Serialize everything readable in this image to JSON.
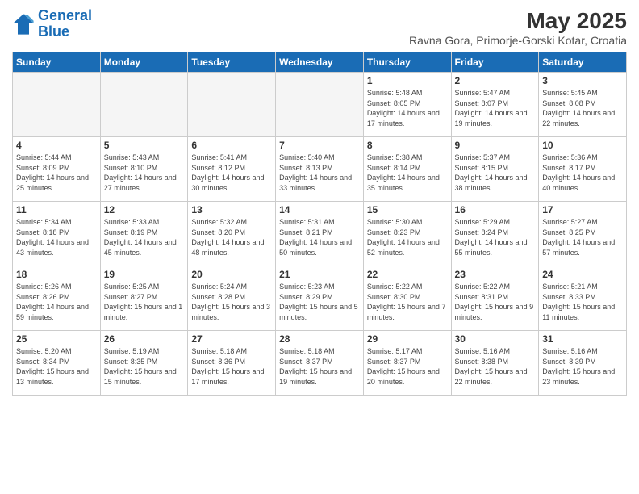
{
  "logo": {
    "line1": "General",
    "line2": "Blue"
  },
  "title": "May 2025",
  "subtitle": "Ravna Gora, Primorje-Gorski Kotar, Croatia",
  "days_of_week": [
    "Sunday",
    "Monday",
    "Tuesday",
    "Wednesday",
    "Thursday",
    "Friday",
    "Saturday"
  ],
  "weeks": [
    [
      {
        "day": "",
        "info": ""
      },
      {
        "day": "",
        "info": ""
      },
      {
        "day": "",
        "info": ""
      },
      {
        "day": "",
        "info": ""
      },
      {
        "day": "1",
        "info": "Sunrise: 5:48 AM\nSunset: 8:05 PM\nDaylight: 14 hours\nand 17 minutes."
      },
      {
        "day": "2",
        "info": "Sunrise: 5:47 AM\nSunset: 8:07 PM\nDaylight: 14 hours\nand 19 minutes."
      },
      {
        "day": "3",
        "info": "Sunrise: 5:45 AM\nSunset: 8:08 PM\nDaylight: 14 hours\nand 22 minutes."
      }
    ],
    [
      {
        "day": "4",
        "info": "Sunrise: 5:44 AM\nSunset: 8:09 PM\nDaylight: 14 hours\nand 25 minutes."
      },
      {
        "day": "5",
        "info": "Sunrise: 5:43 AM\nSunset: 8:10 PM\nDaylight: 14 hours\nand 27 minutes."
      },
      {
        "day": "6",
        "info": "Sunrise: 5:41 AM\nSunset: 8:12 PM\nDaylight: 14 hours\nand 30 minutes."
      },
      {
        "day": "7",
        "info": "Sunrise: 5:40 AM\nSunset: 8:13 PM\nDaylight: 14 hours\nand 33 minutes."
      },
      {
        "day": "8",
        "info": "Sunrise: 5:38 AM\nSunset: 8:14 PM\nDaylight: 14 hours\nand 35 minutes."
      },
      {
        "day": "9",
        "info": "Sunrise: 5:37 AM\nSunset: 8:15 PM\nDaylight: 14 hours\nand 38 minutes."
      },
      {
        "day": "10",
        "info": "Sunrise: 5:36 AM\nSunset: 8:17 PM\nDaylight: 14 hours\nand 40 minutes."
      }
    ],
    [
      {
        "day": "11",
        "info": "Sunrise: 5:34 AM\nSunset: 8:18 PM\nDaylight: 14 hours\nand 43 minutes."
      },
      {
        "day": "12",
        "info": "Sunrise: 5:33 AM\nSunset: 8:19 PM\nDaylight: 14 hours\nand 45 minutes."
      },
      {
        "day": "13",
        "info": "Sunrise: 5:32 AM\nSunset: 8:20 PM\nDaylight: 14 hours\nand 48 minutes."
      },
      {
        "day": "14",
        "info": "Sunrise: 5:31 AM\nSunset: 8:21 PM\nDaylight: 14 hours\nand 50 minutes."
      },
      {
        "day": "15",
        "info": "Sunrise: 5:30 AM\nSunset: 8:23 PM\nDaylight: 14 hours\nand 52 minutes."
      },
      {
        "day": "16",
        "info": "Sunrise: 5:29 AM\nSunset: 8:24 PM\nDaylight: 14 hours\nand 55 minutes."
      },
      {
        "day": "17",
        "info": "Sunrise: 5:27 AM\nSunset: 8:25 PM\nDaylight: 14 hours\nand 57 minutes."
      }
    ],
    [
      {
        "day": "18",
        "info": "Sunrise: 5:26 AM\nSunset: 8:26 PM\nDaylight: 14 hours\nand 59 minutes."
      },
      {
        "day": "19",
        "info": "Sunrise: 5:25 AM\nSunset: 8:27 PM\nDaylight: 15 hours\nand 1 minute."
      },
      {
        "day": "20",
        "info": "Sunrise: 5:24 AM\nSunset: 8:28 PM\nDaylight: 15 hours\nand 3 minutes."
      },
      {
        "day": "21",
        "info": "Sunrise: 5:23 AM\nSunset: 8:29 PM\nDaylight: 15 hours\nand 5 minutes."
      },
      {
        "day": "22",
        "info": "Sunrise: 5:22 AM\nSunset: 8:30 PM\nDaylight: 15 hours\nand 7 minutes."
      },
      {
        "day": "23",
        "info": "Sunrise: 5:22 AM\nSunset: 8:31 PM\nDaylight: 15 hours\nand 9 minutes."
      },
      {
        "day": "24",
        "info": "Sunrise: 5:21 AM\nSunset: 8:33 PM\nDaylight: 15 hours\nand 11 minutes."
      }
    ],
    [
      {
        "day": "25",
        "info": "Sunrise: 5:20 AM\nSunset: 8:34 PM\nDaylight: 15 hours\nand 13 minutes."
      },
      {
        "day": "26",
        "info": "Sunrise: 5:19 AM\nSunset: 8:35 PM\nDaylight: 15 hours\nand 15 minutes."
      },
      {
        "day": "27",
        "info": "Sunrise: 5:18 AM\nSunset: 8:36 PM\nDaylight: 15 hours\nand 17 minutes."
      },
      {
        "day": "28",
        "info": "Sunrise: 5:18 AM\nSunset: 8:37 PM\nDaylight: 15 hours\nand 19 minutes."
      },
      {
        "day": "29",
        "info": "Sunrise: 5:17 AM\nSunset: 8:37 PM\nDaylight: 15 hours\nand 20 minutes."
      },
      {
        "day": "30",
        "info": "Sunrise: 5:16 AM\nSunset: 8:38 PM\nDaylight: 15 hours\nand 22 minutes."
      },
      {
        "day": "31",
        "info": "Sunrise: 5:16 AM\nSunset: 8:39 PM\nDaylight: 15 hours\nand 23 minutes."
      }
    ]
  ]
}
